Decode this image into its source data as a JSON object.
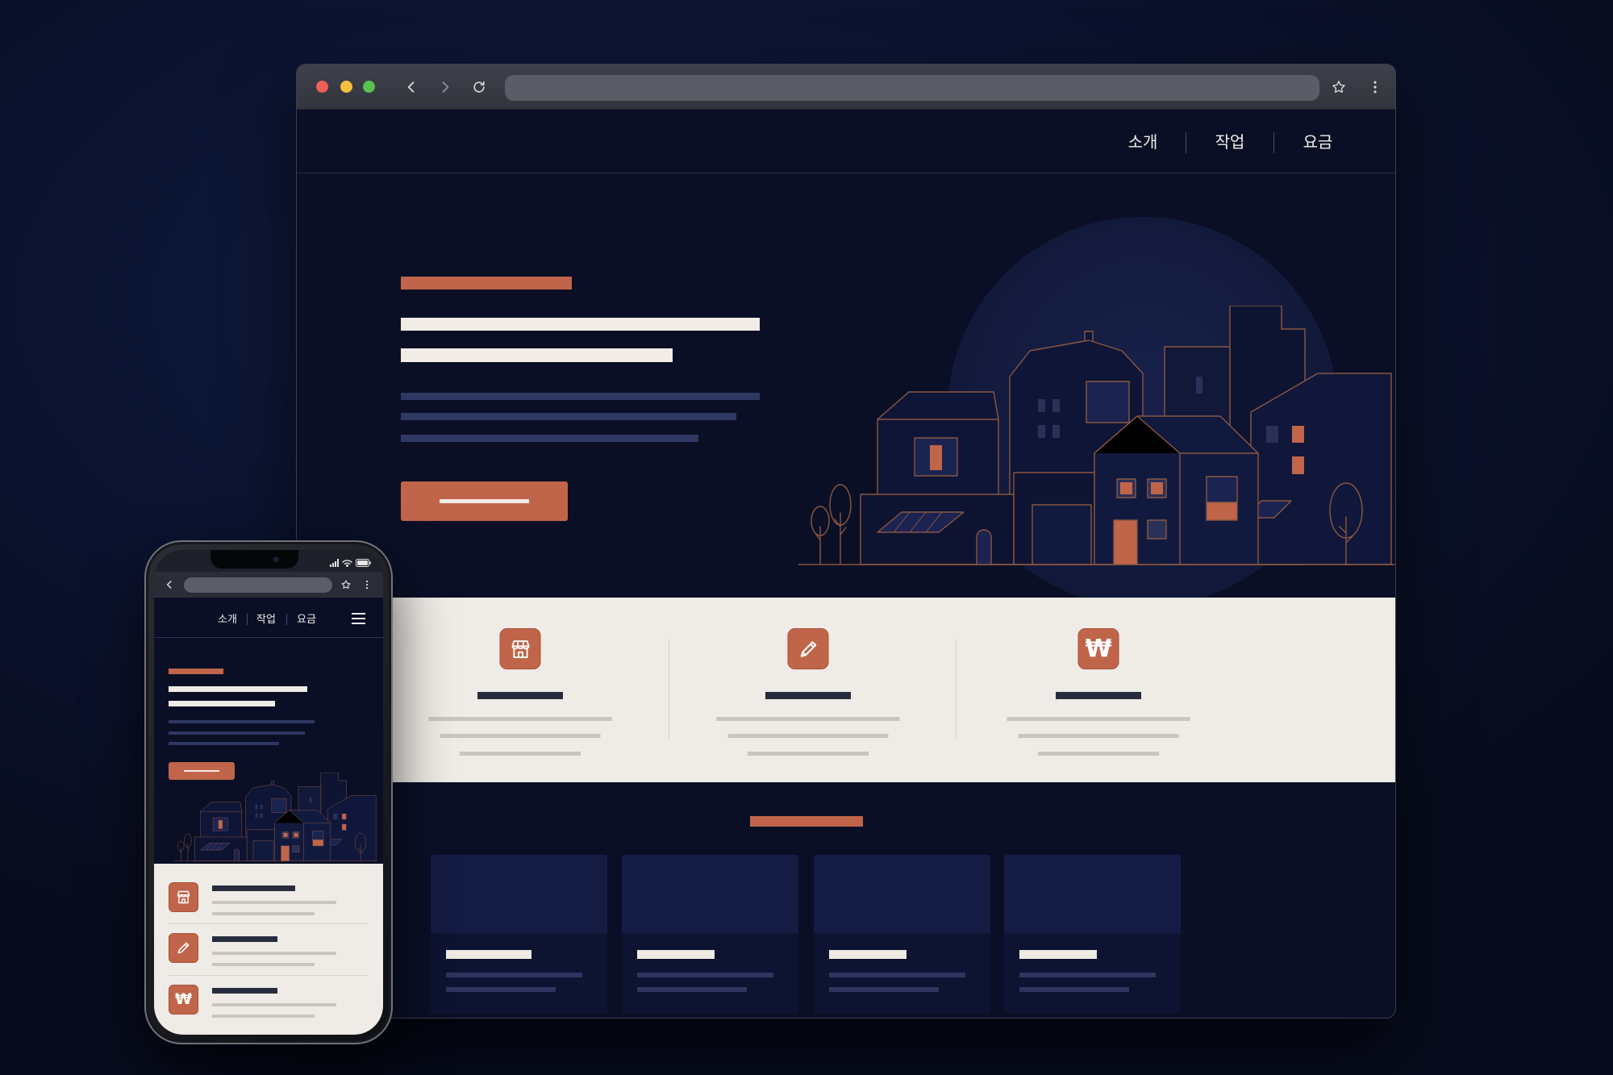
{
  "colors": {
    "page": "#0a0f26",
    "accent": "#c0654a",
    "cream": "#efebe6",
    "card": "#151c44"
  },
  "browser": {
    "window_controls": [
      "close-icon",
      "minimize-icon",
      "maximize-icon"
    ],
    "toolbar": {
      "back_icon": "chevron-left-icon",
      "forward_icon": "chevron-right-icon",
      "reload_icon": "reload-icon",
      "bookmark_icon": "star-icon",
      "menu_icon": "kebab-menu-icon"
    },
    "nav": {
      "items": [
        {
          "label": "소개"
        },
        {
          "label": "작업"
        },
        {
          "label": "요금"
        }
      ]
    }
  },
  "features": [
    {
      "icon": "store-icon"
    },
    {
      "icon": "pencil-icon"
    },
    {
      "icon": "won-icon",
      "glyph": "₩"
    }
  ],
  "phone": {
    "status_icons": [
      "signal-icon",
      "wifi-icon",
      "battery-icon"
    ],
    "toolbar": {
      "back_icon": "chevron-left-icon",
      "bookmark_icon": "star-icon",
      "menu_icon": "kebab-menu-icon"
    },
    "nav": {
      "items": [
        {
          "label": "소개"
        },
        {
          "label": "작업"
        },
        {
          "label": "요금"
        }
      ],
      "menu_icon": "hamburger-menu-icon"
    }
  }
}
